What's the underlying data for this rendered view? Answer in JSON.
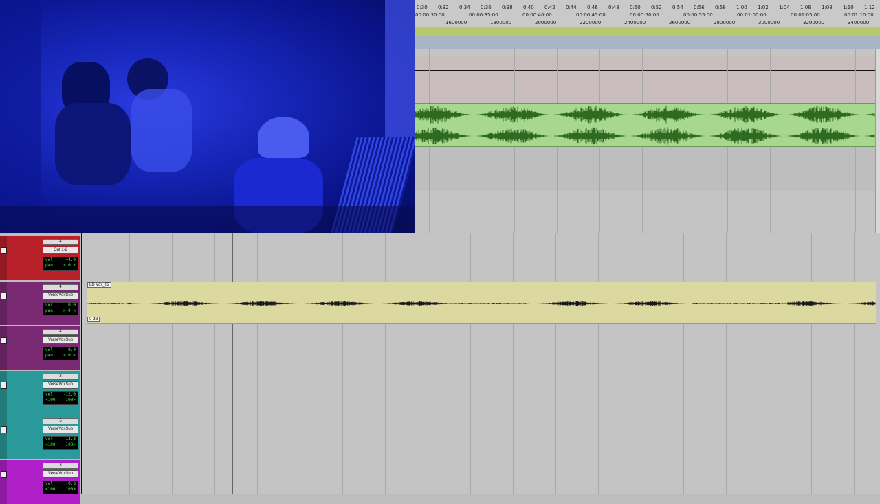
{
  "ruler": {
    "minutes": [
      "0:30",
      "0:32",
      "0:34",
      "0:36",
      "0:38",
      "0:40",
      "0:42",
      "0:44",
      "0:46",
      "0:48",
      "0:50",
      "0:52",
      "0:54",
      "0:56",
      "0:58",
      "1:00",
      "1:02",
      "1:04",
      "1:06",
      "1:08",
      "1:10",
      "1:12"
    ],
    "timecodes": [
      "00:00:30:00",
      "00:00:35:00",
      "00:00:40:00",
      "00:00:45:00",
      "00:00:50:00",
      "00:00:55:00",
      "00:01:00:00",
      "00:01:05:00",
      "00:01:10:00"
    ],
    "samples": [
      "1600000",
      "1800000",
      "2000000",
      "2200000",
      "2400000",
      "2600000",
      "2800000",
      "3000000",
      "3200000",
      "3400000"
    ]
  },
  "tracks": [
    {
      "num": "4",
      "name": "Out 1-2",
      "vol_label": "vol.",
      "vol": "+4.9",
      "pan_label": "pan.",
      "pan": "> 0 <",
      "color": "#b8202a"
    },
    {
      "num": "4",
      "name": "VerseVoxSub",
      "vol_label": "vol.",
      "vol": "0.0",
      "pan_label": "pan.",
      "pan": "> 0 <",
      "color": "#7a2a72"
    },
    {
      "num": "4",
      "name": "VerseVoxSub",
      "vol_label": "vol.",
      "vol": "0.0",
      "pan_label": "pan.",
      "pan": "> 0 <",
      "color": "#7a2a72"
    },
    {
      "num": "3",
      "name": "VerseVoxSub",
      "vol_label": "vol.",
      "vol": "-12.0",
      "pan_label": "<100",
      "pan": "100>",
      "color": "#2a9a9a"
    },
    {
      "num": "5",
      "name": "VerseVoxSub",
      "vol_label": "vol.",
      "vol": "-13.3",
      "pan_label": "<100",
      "pan": "100>",
      "color": "#2a9a9a"
    },
    {
      "num": "3",
      "name": "VerseVoxSub",
      "vol_label": "vol.",
      "vol": "-0.8",
      "pan_label": "<100",
      "pan": "100>",
      "color": "#b020c8"
    }
  ],
  "clips": {
    "top_clip_color": "#a8d890",
    "lead_clip_name": "LD Vox_02",
    "lead_clip_gain": "0 dB",
    "lead_clip_color": "#dcd9a0"
  }
}
